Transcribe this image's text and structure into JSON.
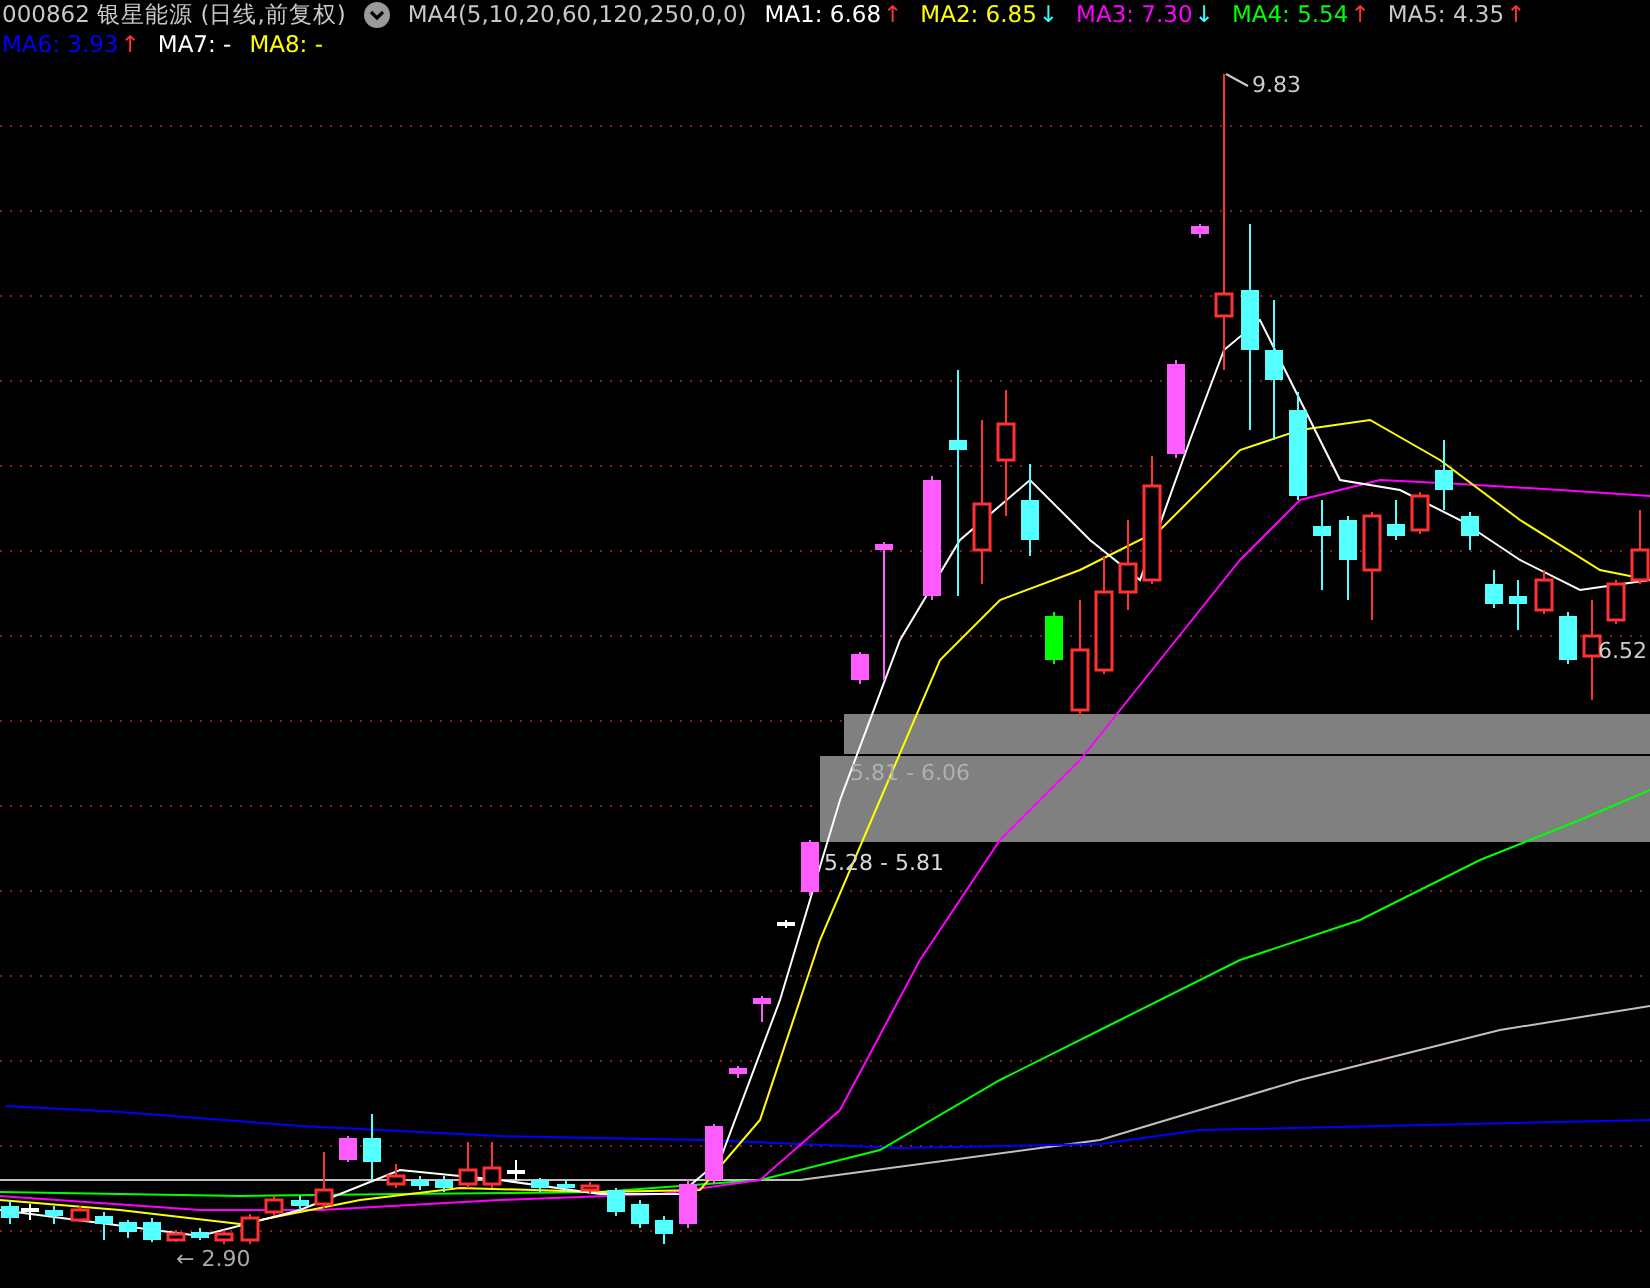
{
  "header": {
    "title": "000862 银星能源 (日线,前复权)",
    "indicator": "MA4(5,10,20,60,120,250,0,0)"
  },
  "ma_legend": [
    {
      "label": "MA1: 6.68",
      "color": "#ffffff",
      "arrow": {
        "text": "↑",
        "rising": true
      }
    },
    {
      "label": "MA2: 6.85",
      "color": "#ffff00",
      "arrow": {
        "text": "↓",
        "rising": false
      }
    },
    {
      "label": "MA3: 7.30",
      "color": "#ff00ff",
      "arrow": {
        "text": "↓",
        "rising": false
      }
    },
    {
      "label": "MA4: 5.54",
      "color": "#00ff00",
      "arrow": {
        "text": "↑",
        "rising": true
      }
    },
    {
      "label": "MA5: 4.35",
      "color": "#c8c8c8",
      "arrow": {
        "text": "↑",
        "rising": true
      }
    },
    {
      "label": "MA6: 3.93",
      "color": "#0000ff",
      "arrow": {
        "text": "↑",
        "rising": true
      }
    },
    {
      "label": "MA7: -",
      "color": "#ffffff"
    },
    {
      "label": "MA8: -",
      "color": "#ffff00"
    }
  ],
  "chart": {
    "high_label": "9.83",
    "last_label": "6.52",
    "low_label": "← 2.90",
    "zones": [
      {
        "label": "5.81 - 6.06"
      },
      {
        "label": "5.28 - 5.81"
      }
    ]
  }
}
